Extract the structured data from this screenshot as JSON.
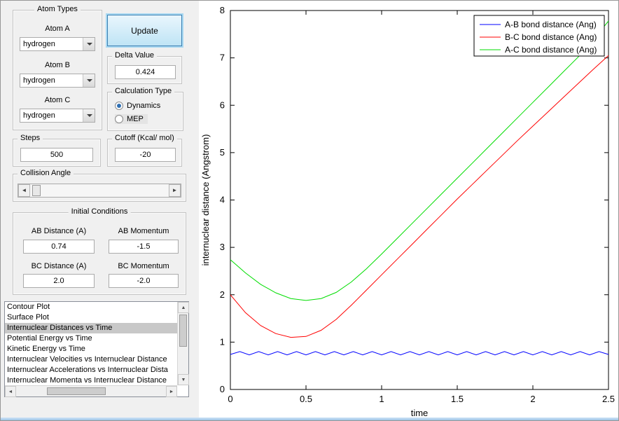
{
  "atom_types": {
    "title": "Atom Types",
    "fields": [
      {
        "label": "Atom A",
        "value": "hydrogen"
      },
      {
        "label": "Atom B",
        "value": "hydrogen"
      },
      {
        "label": "Atom C",
        "value": "hydrogen"
      }
    ]
  },
  "update_label": "Update",
  "delta": {
    "title": "Delta Value",
    "value": "0.424"
  },
  "calculation": {
    "title": "Calculation Type",
    "options": [
      {
        "label": "Dynamics"
      },
      {
        "label": "MEP"
      }
    ],
    "selected": "Dynamics"
  },
  "steps": {
    "title": "Steps",
    "value": "500"
  },
  "cutoff": {
    "title": "Cutoff (Kcal/ mol)",
    "value": "-20"
  },
  "collision": {
    "title": "Collision Angle"
  },
  "initial": {
    "title": "Initial Conditions",
    "ab_distance_label": "AB Distance (A)",
    "ab_distance_value": "0.74",
    "ab_momentum_label": "AB Momentum",
    "ab_momentum_value": "-1.5",
    "bc_distance_label": "BC Distance (A)",
    "bc_distance_value": "2.0",
    "bc_momentum_label": "BC Momentum",
    "bc_momentum_value": "-2.0"
  },
  "listbox": {
    "items": [
      "Contour Plot",
      "Surface Plot",
      "Internuclear Distances vs Time",
      "Potential Energy vs Time",
      "Kinetic Energy vs Time",
      "Internuclear Velocities vs Internuclear Distance",
      "Internuclear Accelerations vs Internuclear Dista",
      "Internuclear Momenta vs Internuclear Distance"
    ],
    "selected_index": 2
  },
  "chart_data": {
    "type": "line",
    "title": "",
    "xlabel": "time",
    "ylabel": "internuclear distance (Angstrom)",
    "xlim": [
      0,
      2.5
    ],
    "ylim": [
      0,
      8
    ],
    "xticks": [
      0,
      0.5,
      1,
      1.5,
      2,
      2.5
    ],
    "yticks": [
      0,
      1,
      2,
      3,
      4,
      5,
      6,
      7,
      8
    ],
    "grid": false,
    "legend_position": "top-right",
    "series": [
      {
        "name": "A-B bond distance (Ang)",
        "color": "#0000ff",
        "x0": 0,
        "dx": 0.0625,
        "y": [
          0.74,
          0.8,
          0.73,
          0.8,
          0.73,
          0.8,
          0.73,
          0.8,
          0.73,
          0.8,
          0.73,
          0.8,
          0.73,
          0.8,
          0.73,
          0.8,
          0.73,
          0.8,
          0.73,
          0.8,
          0.73,
          0.8,
          0.73,
          0.8,
          0.73,
          0.8,
          0.73,
          0.8,
          0.73,
          0.8,
          0.73,
          0.8,
          0.73,
          0.8,
          0.73,
          0.8,
          0.73,
          0.8,
          0.73,
          0.8,
          0.74
        ]
      },
      {
        "name": "B-C bond distance (Ang)",
        "color": "#ff0000",
        "x0": 0,
        "dx": 0.1,
        "y": [
          2.0,
          1.62,
          1.35,
          1.18,
          1.1,
          1.12,
          1.25,
          1.48,
          1.78,
          2.1,
          2.42,
          2.74,
          3.06,
          3.38,
          3.7,
          4.02,
          4.33,
          4.64,
          4.95,
          5.26,
          5.56,
          5.86,
          6.16,
          6.46,
          6.76,
          7.05
        ]
      },
      {
        "name": "A-C bond distance (Ang)",
        "color": "#00dd00",
        "x0": 0,
        "dx": 0.1,
        "y": [
          2.74,
          2.46,
          2.22,
          2.04,
          1.92,
          1.88,
          1.92,
          2.05,
          2.27,
          2.55,
          2.86,
          3.18,
          3.5,
          3.82,
          4.14,
          4.46,
          4.78,
          5.1,
          5.42,
          5.74,
          6.06,
          6.38,
          6.7,
          7.02,
          7.38,
          7.78
        ]
      }
    ]
  }
}
